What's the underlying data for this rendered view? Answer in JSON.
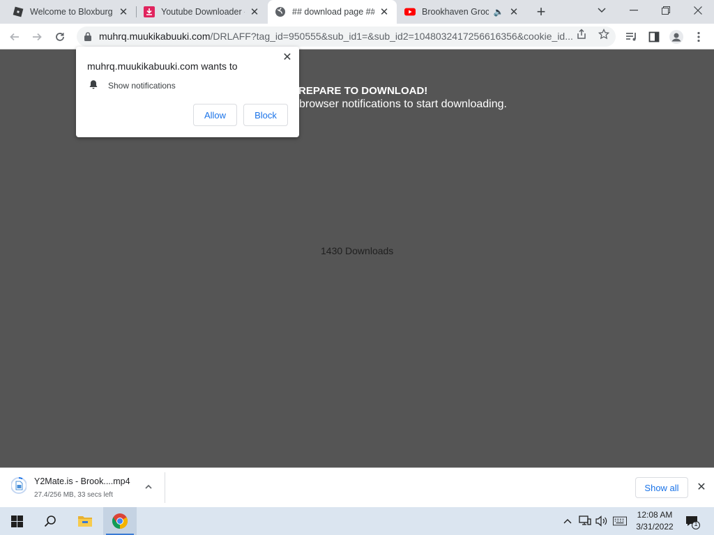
{
  "browser": {
    "tabs": [
      {
        "title": "Welcome to Bloxburg - ",
        "icon": "roblox-icon",
        "active": false
      },
      {
        "title": "Youtube Downloader - ",
        "icon": "download-site-icon",
        "active": false
      },
      {
        "title": "## download page ##",
        "icon": "globe-icon",
        "active": true
      },
      {
        "title": "Brookhaven Groce",
        "icon": "youtube-icon",
        "active": false,
        "audio": true
      }
    ],
    "url": {
      "host": "muhrq.muukikabuuki.com",
      "path": "/DRLAFF?tag_id=950555&sub_id1=&sub_id2=1048032417256616356&cookie_id..."
    }
  },
  "page": {
    "headline": "REPARE TO DOWNLOAD!",
    "subline": "browser notifications to start downloading.",
    "downloads_count": "1430 Downloads"
  },
  "permission_popup": {
    "title": "muhrq.muukikabuuki.com wants to",
    "permission": "Show notifications",
    "allow_label": "Allow",
    "block_label": "Block"
  },
  "download_shelf": {
    "file_name": "Y2Mate.is - Brook....mp4",
    "status": "27.4/256 MB, 33 secs left",
    "show_all_label": "Show all"
  },
  "taskbar": {
    "time": "12:08 AM",
    "date": "3/31/2022",
    "notification_count": "1"
  },
  "colors": {
    "page_bg": "#555555",
    "accent": "#1a73e8",
    "tabstrip": "#dee1e6",
    "taskbar": "#dbe5f0"
  }
}
